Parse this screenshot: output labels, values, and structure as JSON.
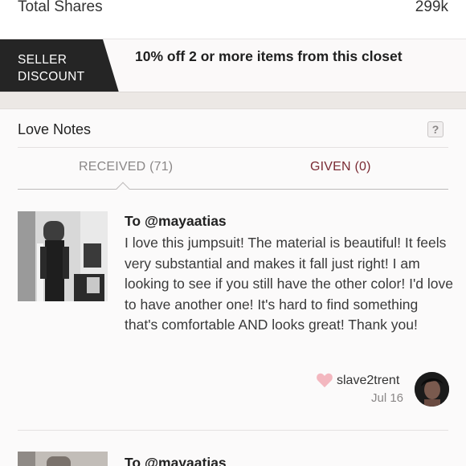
{
  "stats": {
    "label": "Total Shares",
    "value": "299k"
  },
  "seller_discount": {
    "tag_line1": "SELLER",
    "tag_line2": "DISCOUNT",
    "text": "10% off 2 or more items from this closet"
  },
  "love_notes": {
    "title": "Love Notes",
    "help_icon": "?",
    "tabs": {
      "received_label": "RECEIVED",
      "received_count": "(71)",
      "given_label": "GIVEN",
      "given_count": "(0)"
    },
    "notes": [
      {
        "to": "To @mayaatias",
        "body": "I love this jumpsuit! The material is beautiful! It feels very substantial and makes it fall just right! I am looking to see if you still have the other color! I'd love to have another one! It's hard to find something that's comfortable AND looks great! Thank you!",
        "user": "slave2trent",
        "date": "Jul 16",
        "heart_icon": "heart-icon"
      },
      {
        "to": "To @mayaatias"
      }
    ]
  },
  "colors": {
    "tag_background": "#252525",
    "heart": "#f3b7bf",
    "given_tab": "#7a2a33",
    "muted": "#8a8787"
  }
}
